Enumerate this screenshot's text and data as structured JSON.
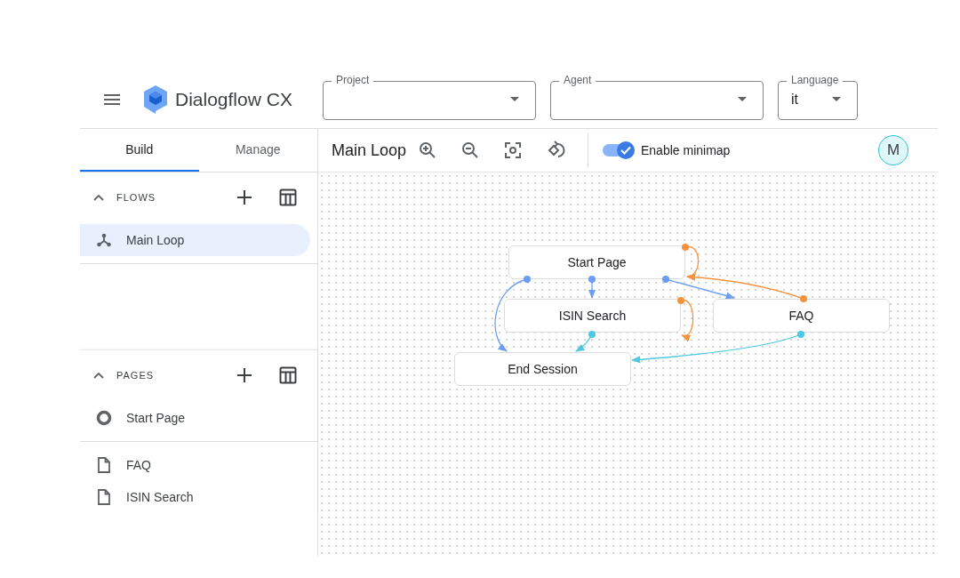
{
  "app": {
    "title": "Dialogflow CX"
  },
  "selectors": [
    {
      "label": "Project"
    },
    {
      "label": "Agent"
    },
    {
      "label": "Language",
      "value": "it"
    }
  ],
  "tabs": [
    {
      "label": "Build",
      "selected": true
    },
    {
      "label": "Manage",
      "selected": false
    }
  ],
  "flows": {
    "heading": "FLOWS",
    "expanded": true,
    "items": [
      {
        "label": "Main Loop",
        "selected": true
      }
    ]
  },
  "pages": {
    "heading": "PAGES",
    "expanded": true,
    "items": [
      {
        "label": "Start Page",
        "kind": "start"
      },
      {
        "label": "FAQ",
        "kind": "page"
      },
      {
        "label": "ISIN Search",
        "kind": "page"
      }
    ]
  },
  "canvas": {
    "title": "Main Loop",
    "minimap": {
      "label": "Enable minimap",
      "on": true
    },
    "avatar": "M",
    "nodes": [
      {
        "label": "Start Page"
      },
      {
        "label": "ISIN Search"
      },
      {
        "label": "FAQ"
      },
      {
        "label": "End Session"
      }
    ],
    "edges": [
      {
        "color": "#6b9ef0"
      },
      {
        "color": "#6b9ef0"
      },
      {
        "color": "#6b9ef0"
      },
      {
        "color": "#f5923e"
      },
      {
        "color": "#f5923e"
      },
      {
        "color": "#f5923e"
      },
      {
        "color": "#4fc8e0"
      },
      {
        "color": "#4fc8e0"
      }
    ]
  }
}
